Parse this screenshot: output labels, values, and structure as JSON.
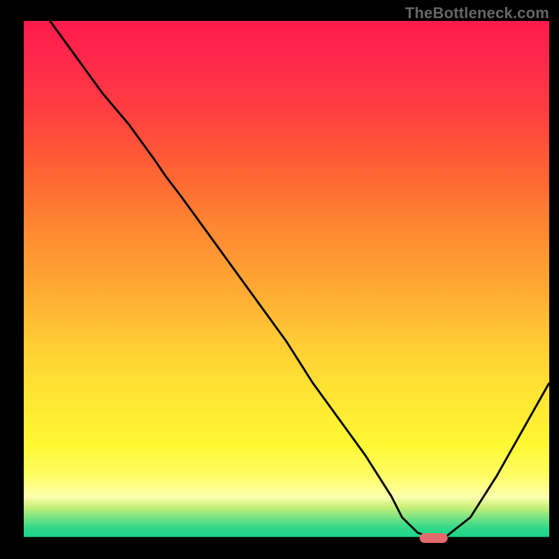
{
  "watermark": "TheBottleneck.com",
  "chart_data": {
    "type": "line",
    "title": "",
    "xlabel": "",
    "ylabel": "",
    "xlim": [
      0,
      100
    ],
    "ylim": [
      0,
      100
    ],
    "series": [
      {
        "name": "bottleneck-curve",
        "x": [
          5,
          10,
          15,
          20,
          25,
          27,
          30,
          35,
          40,
          45,
          50,
          55,
          60,
          65,
          70,
          72,
          75,
          78,
          80,
          85,
          90,
          95,
          100
        ],
        "values": [
          100,
          93,
          86,
          80,
          73,
          70,
          66,
          59,
          52,
          45,
          38,
          30,
          23,
          16,
          8,
          4,
          1,
          0,
          0,
          4,
          12,
          21,
          30
        ]
      }
    ],
    "marker": {
      "x": 78,
      "y": 0
    },
    "baseline_y": 0,
    "legend": false,
    "grid": false
  },
  "colors": {
    "gradient_top": "#ff1a4d",
    "gradient_bottom": "#17d488",
    "curve": "#000000",
    "marker": "#e46a6d",
    "frame": "#000000"
  }
}
